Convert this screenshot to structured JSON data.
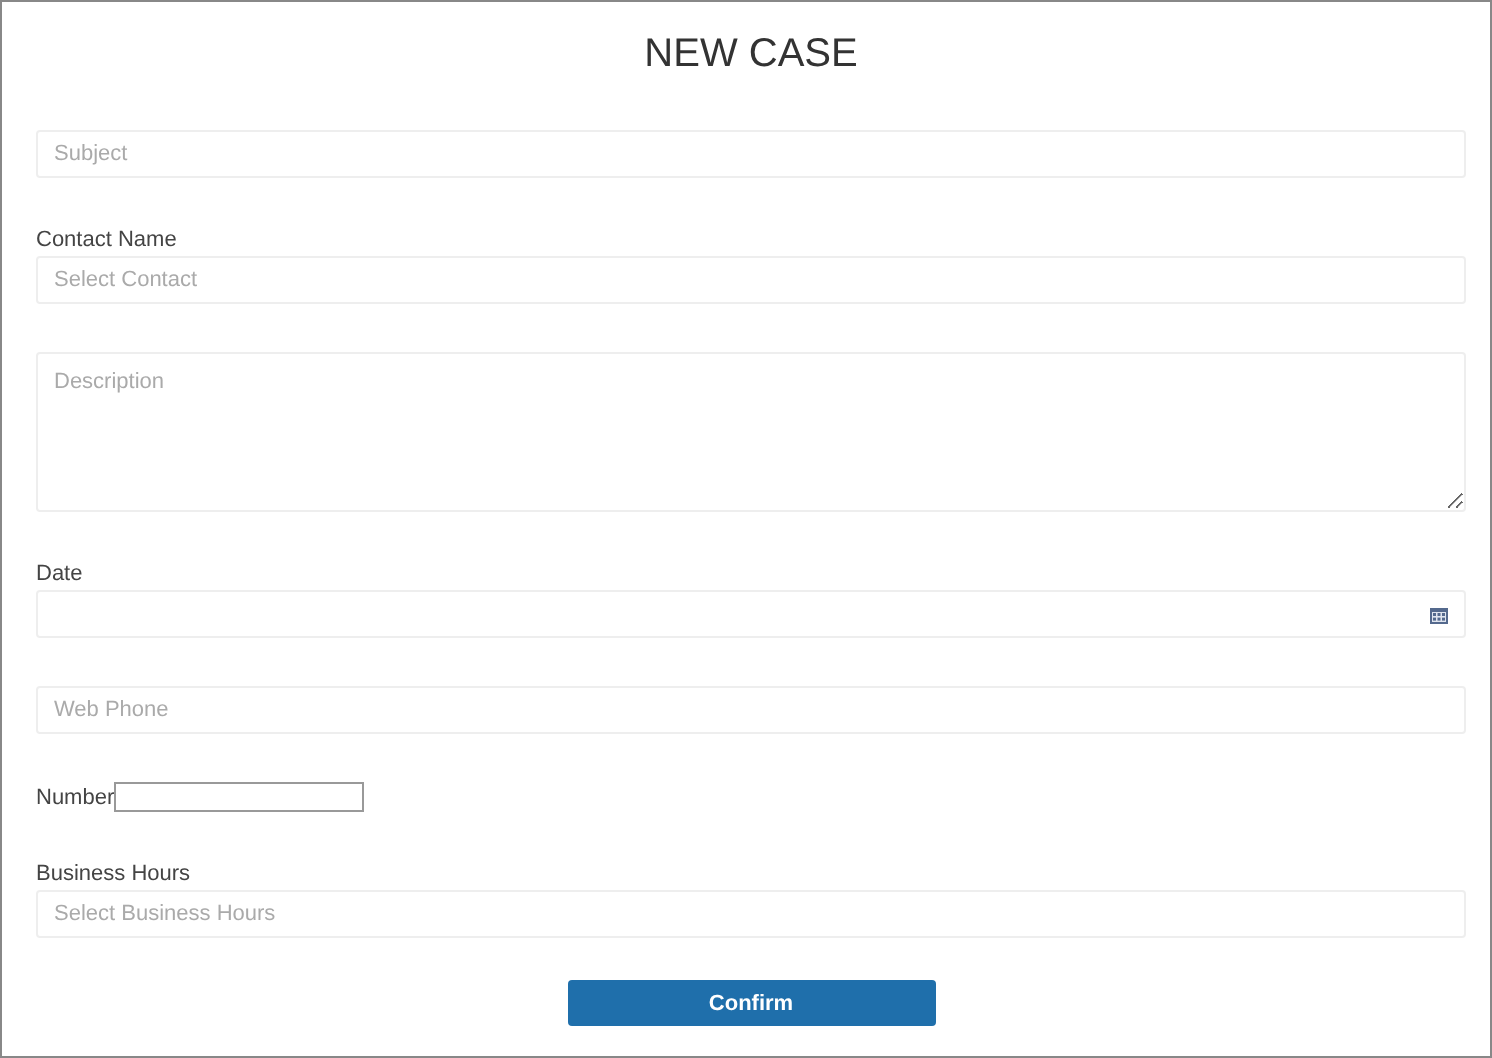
{
  "title": "NEW CASE",
  "fields": [
    {
      "kind": "text",
      "placeholder": "Subject"
    },
    {
      "kind": "select",
      "label": "Contact Name",
      "placeholder": "Select Contact"
    },
    {
      "kind": "textarea",
      "placeholder": "Description"
    },
    {
      "kind": "date",
      "label": "Date"
    },
    {
      "kind": "text",
      "placeholder": "Web Phone"
    },
    {
      "kind": "inline",
      "label": "Number"
    },
    {
      "kind": "select",
      "label": "Business Hours",
      "placeholder": "Select Business Hours"
    }
  ],
  "submit": "Confirm"
}
